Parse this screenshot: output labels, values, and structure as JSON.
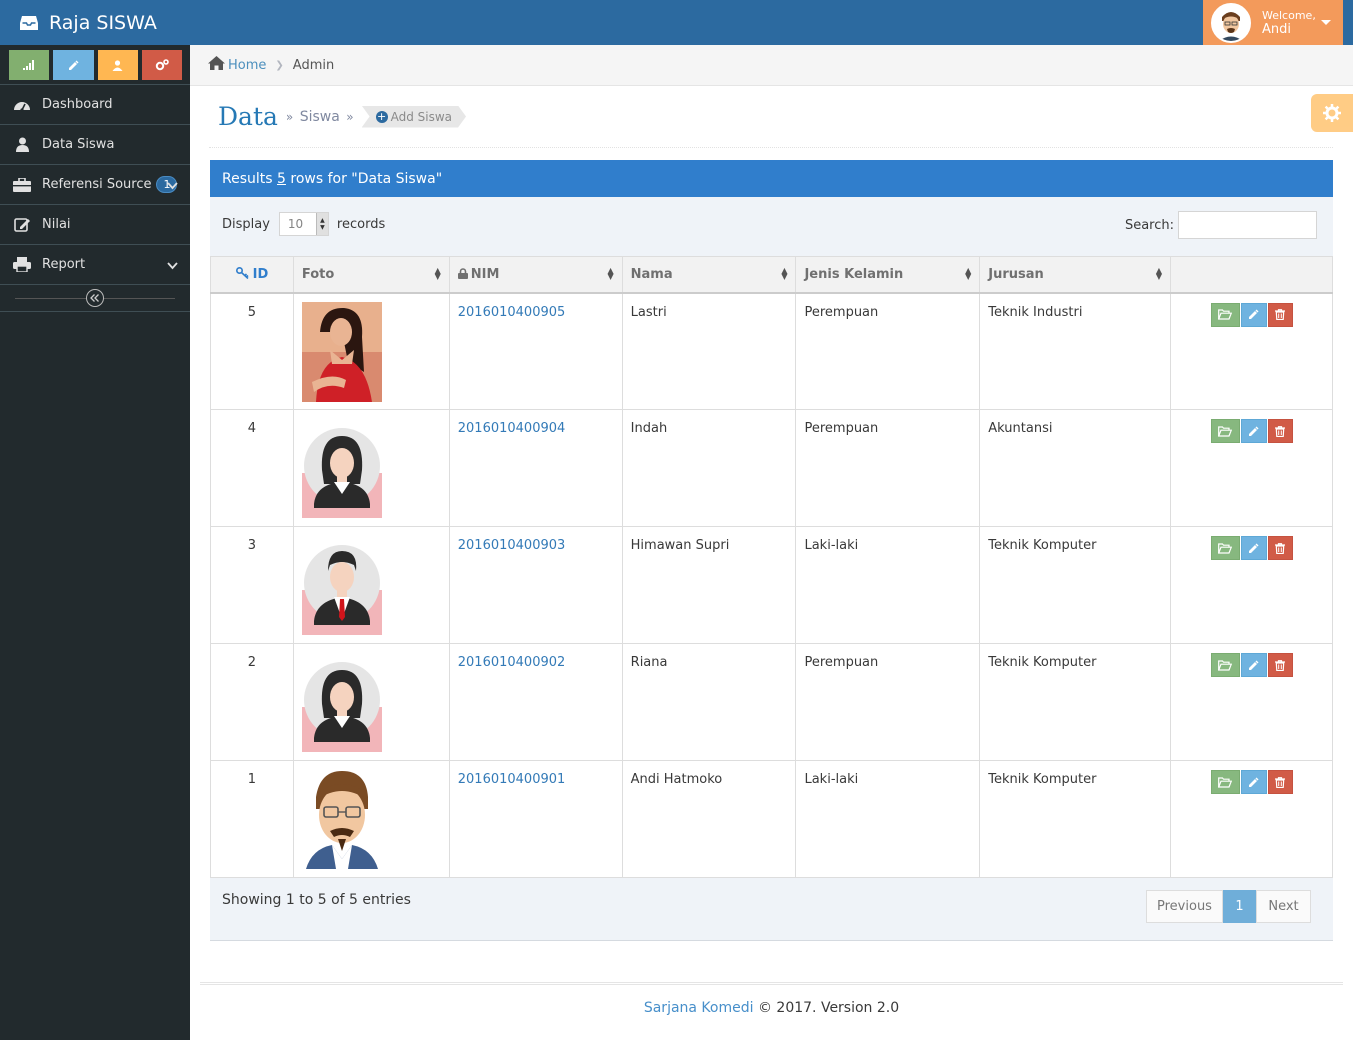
{
  "app": {
    "title": "Raja SISWA"
  },
  "user": {
    "welcome": "Welcome,",
    "name": "Andi"
  },
  "sidebar": {
    "items": [
      {
        "label": "Dashboard",
        "icon": "dashboard-icon"
      },
      {
        "label": "Data Siswa",
        "icon": "user-icon"
      },
      {
        "label": "Referensi Source",
        "icon": "briefcase-icon",
        "badge": "1"
      },
      {
        "label": "Nilai",
        "icon": "edit-icon"
      },
      {
        "label": "Report",
        "icon": "print-icon"
      }
    ]
  },
  "breadcrumb": {
    "home": "Home",
    "current": "Admin"
  },
  "header": {
    "title": "Data",
    "sub": "Siswa",
    "add_label": "Add Siswa"
  },
  "panel": {
    "prefix": "Results",
    "count": "5",
    "suffix": "rows for \"Data Siswa\""
  },
  "controls": {
    "display": "Display",
    "length": "10",
    "records": "records",
    "search": "Search:"
  },
  "table": {
    "headers": [
      "ID",
      "Foto",
      "NIM",
      "Nama",
      "Jenis Kelamin",
      "Jurusan"
    ],
    "rows": [
      {
        "id": "5",
        "nim": "2016010400905",
        "nama": "Lastri",
        "jk": "Perempuan",
        "jurusan": "Teknik Industri",
        "photo": "photo-woman-red"
      },
      {
        "id": "4",
        "nim": "2016010400904",
        "nama": "Indah",
        "jk": "Perempuan",
        "jurusan": "Akuntansi",
        "photo": "female-avatar"
      },
      {
        "id": "3",
        "nim": "2016010400903",
        "nama": "Himawan Supri",
        "jk": "Laki-laki",
        "jurusan": "Teknik Komputer",
        "photo": "male-avatar"
      },
      {
        "id": "2",
        "nim": "2016010400902",
        "nama": "Riana",
        "jk": "Perempuan",
        "jurusan": "Teknik Komputer",
        "photo": "female-avatar"
      },
      {
        "id": "1",
        "nim": "2016010400901",
        "nama": "Andi Hatmoko",
        "jk": "Laki-laki",
        "jurusan": "Teknik Komputer",
        "photo": "cartoon-man"
      }
    ]
  },
  "info": "Showing 1 to 5 of 5 entries",
  "pagination": {
    "previous": "Previous",
    "page": "1",
    "next": "Next"
  },
  "footer": {
    "brand": "Sarjana Komedi",
    "text": "© 2017. Version 2.0"
  },
  "colors": {
    "navbar": "#2c6aa0",
    "sidebar": "#222a2d",
    "panel_header": "#307ecc",
    "user_menu": "#f39a5b"
  }
}
